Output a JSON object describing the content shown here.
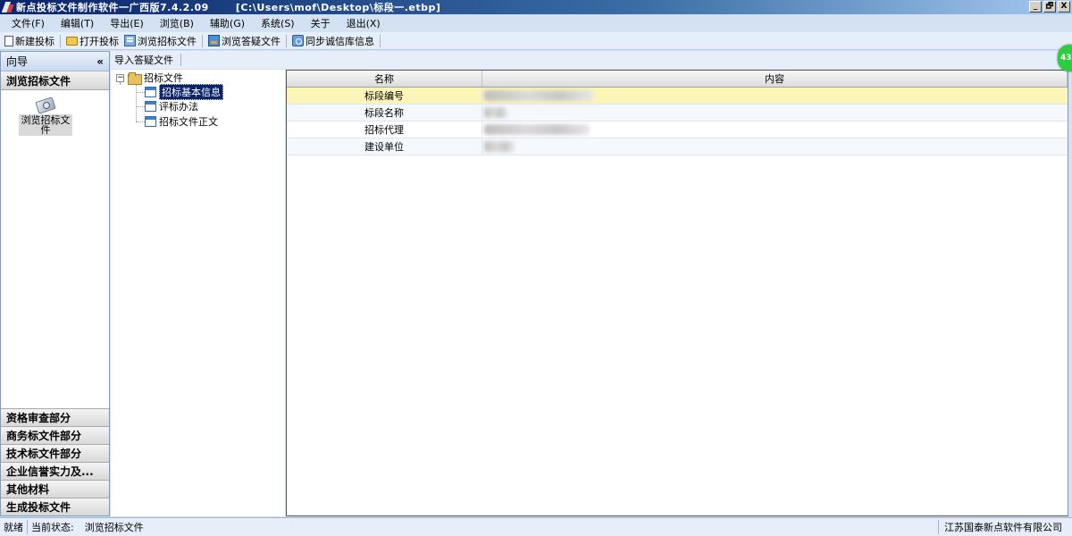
{
  "window": {
    "title": "新点投标文件制作软件一广西版7.4.2.09",
    "path": "[C:\\Users\\mof\\Desktop\\标段一.etbp]",
    "btn_min": "_",
    "btn_restore": "🗗",
    "btn_close": "X"
  },
  "menu": {
    "items": [
      "文件(F)",
      "编辑(T)",
      "导出(E)",
      "浏览(B)",
      "辅助(G)",
      "系统(S)",
      "关于",
      "退出(X)"
    ]
  },
  "toolbar": {
    "new_bid": "新建投标",
    "open_bid": "打开投标",
    "browse_tender": "浏览招标文件",
    "browse_qa": "浏览答疑文件",
    "sync_credit": "同步诚信库信息"
  },
  "sidebar": {
    "header": "向导",
    "collapse": "«",
    "active_section": "浏览招标文件",
    "tile_label": "浏览招标文件",
    "sections": [
      "资格审查部分",
      "商务标文件部分",
      "技术标文件部分",
      "企业信誉实力及...",
      "其他材料",
      "生成投标文件"
    ]
  },
  "subtoolbar": {
    "import_qa": "导入答疑文件"
  },
  "tree": {
    "root_expander": "−",
    "root": "招标文件",
    "children": [
      "招标基本信息",
      "评标办法",
      "招标文件正文"
    ]
  },
  "grid": {
    "headers": {
      "name": "名称",
      "content": "内容"
    },
    "rows": [
      {
        "name": "标段编号"
      },
      {
        "name": "标段名称"
      },
      {
        "name": "招标代理"
      },
      {
        "name": "建设单位"
      }
    ]
  },
  "badge": {
    "text": "43"
  },
  "status": {
    "ready": "就绪",
    "current_label": "当前状态:",
    "current_value": "浏览招标文件",
    "company": "江苏国泰新点软件有限公司"
  }
}
